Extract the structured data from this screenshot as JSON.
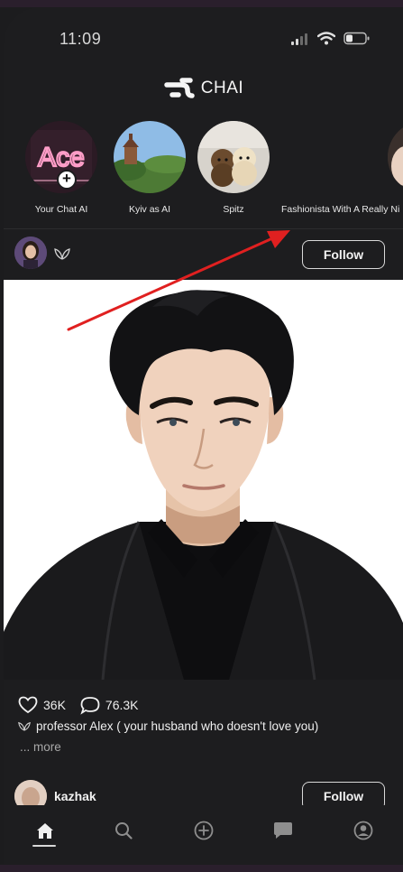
{
  "status_bar": {
    "time": "11:09"
  },
  "header": {
    "app_name": "CHAI"
  },
  "stories": [
    {
      "label": "Your Chat AI",
      "avatar_text": "Ace"
    },
    {
      "label": "Kyiv as AI"
    },
    {
      "label": "Spitz"
    },
    {
      "label": "Fashionista With A Really Ni"
    }
  ],
  "post": {
    "follow_label": "Follow",
    "likes": "36K",
    "comments": "76.3K",
    "caption": "professor Alex ( your husband who doesn't love you)",
    "more_label": "... more"
  },
  "next_post": {
    "username": "kazhak",
    "follow_label": "Follow"
  },
  "tab_bar": {
    "items": [
      {
        "icon": "home-icon",
        "active": true
      },
      {
        "icon": "search-icon"
      },
      {
        "icon": "add-circle-icon"
      },
      {
        "icon": "chat-bubble-icon"
      },
      {
        "icon": "profile-icon"
      }
    ]
  },
  "colors": {
    "background": "#1d1d1f",
    "annotation_arrow": "#e02020",
    "text": "#f2f2f2",
    "muted": "#a8a8a8"
  }
}
